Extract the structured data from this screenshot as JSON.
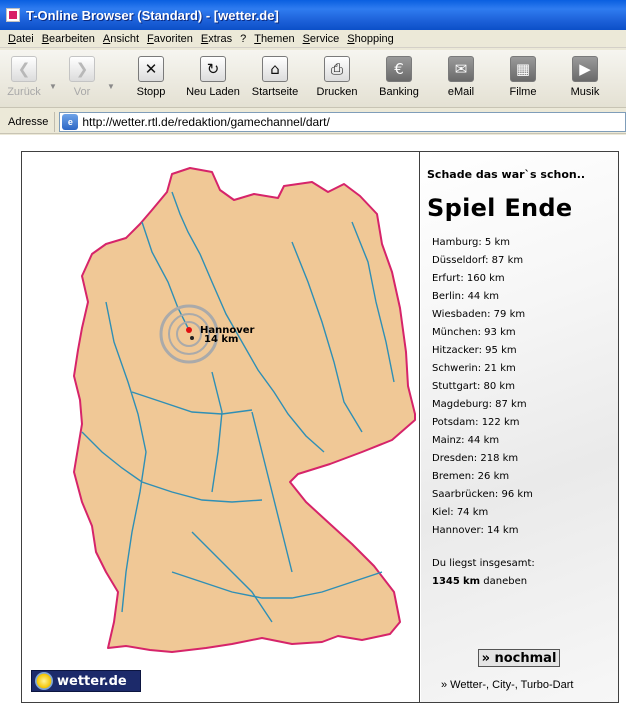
{
  "window": {
    "title": "T-Online Browser (Standard) - [wetter.de]"
  },
  "menu": [
    {
      "label": "Datei"
    },
    {
      "label": "Bearbeiten"
    },
    {
      "label": "Ansicht"
    },
    {
      "label": "Favoriten"
    },
    {
      "label": "Extras"
    },
    {
      "label": "?"
    },
    {
      "label": "Themen"
    },
    {
      "label": "Service"
    },
    {
      "label": "Shopping"
    }
  ],
  "toolbar": {
    "back": {
      "label": "Zurück",
      "icon": "back-arrow-icon",
      "enabled": false
    },
    "forward": {
      "label": "Vor",
      "icon": "forward-arrow-icon",
      "enabled": false
    },
    "stop": {
      "label": "Stopp",
      "icon": "stop-x-icon"
    },
    "reload": {
      "label": "Neu Laden",
      "icon": "reload-icon"
    },
    "home": {
      "label": "Startseite",
      "icon": "home-icon"
    },
    "print": {
      "label": "Drucken",
      "icon": "printer-icon"
    },
    "banking": {
      "label": "Banking",
      "icon": "euro-icon"
    },
    "email": {
      "label": "eMail",
      "icon": "envelope-icon"
    },
    "films": {
      "label": "Filme",
      "icon": "film-icon"
    },
    "music": {
      "label": "Musik",
      "icon": "play-icon"
    }
  },
  "address": {
    "label": "Adresse",
    "url": "http://wetter.rtl.de/redaktion/gamechannel/dart/"
  },
  "game": {
    "subtitle": "Schade das war`s schon..",
    "heading": "Spiel Ende",
    "results": [
      "Hamburg: 5 km",
      "Düsseldorf: 87 km",
      "Erfurt: 160 km",
      "Berlin: 44 km",
      "Wiesbaden: 79 km",
      "München: 93 km",
      "Hitzacker: 95 km",
      "Schwerin: 21 km",
      "Stuttgart: 80 km",
      "Magdeburg: 87 km",
      "Potsdam: 122 km",
      "Mainz: 44 km",
      "Dresden: 218 km",
      "Bremen: 26 km",
      "Saarbrücken: 96 km",
      "Kiel: 74 km",
      "Hannover: 14 km"
    ],
    "total_label": "Du liegst insgesamt:",
    "total_value": "1345",
    "total_unit": "km",
    "total_suffix": "daneben",
    "again_button": "» nochmal",
    "more_link": "» Wetter-, City-, Turbo-Dart"
  },
  "map": {
    "city_name": "Hannover",
    "city_distance": "14 km",
    "logo_text": "wetter.de"
  },
  "colors": {
    "land": "#f0c896",
    "border": "#d6246a",
    "rivers": "#2f8fb5",
    "titlebar": "#0a5fe0"
  }
}
